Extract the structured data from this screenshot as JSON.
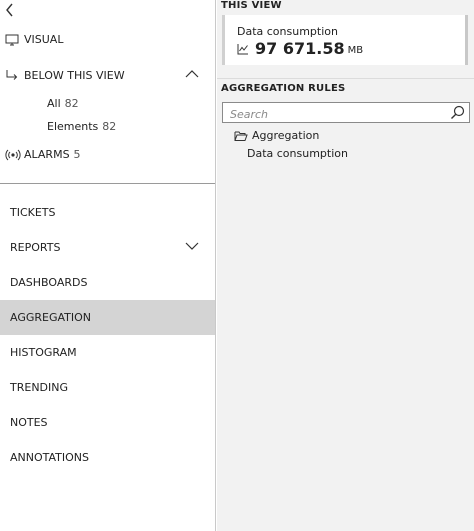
{
  "left_panel": {
    "visual_label": "VISUAL",
    "below_this_view": {
      "label": "BELOW THIS VIEW",
      "all_label": "All",
      "all_count": "82",
      "elements_label": "Elements",
      "elements_count": "82"
    },
    "alarms_label": "ALARMS",
    "alarms_count": "5",
    "menu": [
      {
        "label": "TICKETS"
      },
      {
        "label": "REPORTS"
      },
      {
        "label": "DASHBOARDS"
      },
      {
        "label": "AGGREGATION"
      },
      {
        "label": "HISTOGRAM"
      },
      {
        "label": "TRENDING"
      },
      {
        "label": "NOTES"
      },
      {
        "label": "ANNOTATIONS"
      }
    ],
    "active_item": "AGGREGATION"
  },
  "right_panel": {
    "this_view_title": "THIS VIEW",
    "card": {
      "title": "Data consumption",
      "value": "97 671.58",
      "unit": "MB"
    },
    "aggregation_rules_title": "AGGREGATION RULES",
    "search_placeholder": "Search",
    "tree": {
      "folder": "Aggregation",
      "child": "Data consumption"
    }
  },
  "colors": {
    "active_bg": "#d4d4d4",
    "right_bg": "#f2f2f2"
  }
}
